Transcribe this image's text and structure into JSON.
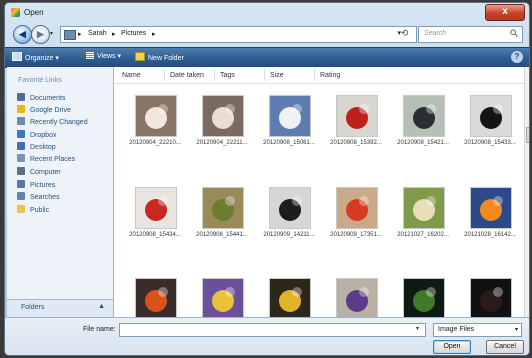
{
  "window": {
    "title": "Open",
    "close_glyph": "x"
  },
  "address": {
    "back_glyph": "◀",
    "forward_glyph": "▶",
    "history_glyph": "▾",
    "sep_glyph": "▸",
    "crumbs": [
      "Sarah",
      "Pictures"
    ],
    "dropdown_glyph": "▾",
    "refresh_glyph": "⟲",
    "search_placeholder": "Search"
  },
  "toolbar": {
    "organize": "Organize ▾",
    "views": "Views ▾",
    "new_folder": "New Folder",
    "help": "?"
  },
  "sidebar": {
    "header": "Favorite Links",
    "items": [
      {
        "label": "Documents",
        "icon": "documents-icon",
        "color": "#4f6f9a"
      },
      {
        "label": "Google Drive",
        "icon": "google-drive-icon",
        "color": "#e9b51f"
      },
      {
        "label": "Recently Changed",
        "icon": "recent-icon",
        "color": "#6d8ab0"
      },
      {
        "label": "Dropbox",
        "icon": "dropbox-icon",
        "color": "#3a78c8"
      },
      {
        "label": "Desktop",
        "icon": "desktop-icon",
        "color": "#3d6fb4"
      },
      {
        "label": "Recent Places",
        "icon": "recent-places-icon",
        "color": "#7d95b4"
      },
      {
        "label": "Computer",
        "icon": "computer-icon",
        "color": "#5a6f8a"
      },
      {
        "label": "Pictures",
        "icon": "pictures-icon",
        "color": "#4f79a8"
      },
      {
        "label": "Searches",
        "icon": "searches-icon",
        "color": "#5d86b6"
      },
      {
        "label": "Public",
        "icon": "public-folder-icon",
        "color": "#e5c35a"
      }
    ],
    "folders_label": "Folders",
    "folders_glyph": "▲"
  },
  "columns": [
    "Name",
    "Date taken",
    "Tags",
    "Size",
    "Rating"
  ],
  "files": [
    {
      "name": "20120904_22210...",
      "bg": "#8a7468",
      "obj": "#efe6dc"
    },
    {
      "name": "20120904_22211...",
      "bg": "#7b6a60",
      "obj": "#e8ddd3"
    },
    {
      "name": "20120908_15061...",
      "bg": "#5e7eb2",
      "obj": "#f1f1f1"
    },
    {
      "name": "20120908_15392...",
      "bg": "#d9d6d2",
      "obj": "#c0201c"
    },
    {
      "name": "20120908_15421...",
      "bg": "#b5c0b7",
      "obj": "#2a2f33"
    },
    {
      "name": "20120908_15433...",
      "bg": "#d9d9d9",
      "obj": "#141414"
    },
    {
      "name": "20120908_15434...",
      "bg": "#e9e4e0",
      "obj": "#c8281f"
    },
    {
      "name": "20120908_15441...",
      "bg": "#9a8a5a",
      "obj": "#6b7d2e"
    },
    {
      "name": "20120909_14211...",
      "bg": "#d6d6d6",
      "obj": "#1d1d1d"
    },
    {
      "name": "20120909_17351...",
      "bg": "#c9a98a",
      "obj": "#d93a22"
    },
    {
      "name": "20121027_16202...",
      "bg": "#7f9a4a",
      "obj": "#e9ddb8"
    },
    {
      "name": "20121028_16142...",
      "bg": "#2c4a8a",
      "obj": "#f08a1e"
    },
    {
      "name": "",
      "bg": "#3a2c2a",
      "obj": "#d8541c"
    },
    {
      "name": "",
      "bg": "#6b4f9a",
      "obj": "#e8c33a"
    },
    {
      "name": "",
      "bg": "#2e2618",
      "obj": "#e0b42a"
    },
    {
      "name": "",
      "bg": "#b9b0a6",
      "obj": "#5a3d8a"
    },
    {
      "name": "",
      "bg": "#0f1a12",
      "obj": "#3f7a2a"
    },
    {
      "name": "",
      "bg": "#111111",
      "obj": "#2a1a1a"
    }
  ],
  "bottom": {
    "filename_label": "File name:",
    "filename_value": "",
    "dropdown_glyph": "▾",
    "filetype": "Image Files",
    "open_label": "Open",
    "cancel_label": "Cancel"
  }
}
